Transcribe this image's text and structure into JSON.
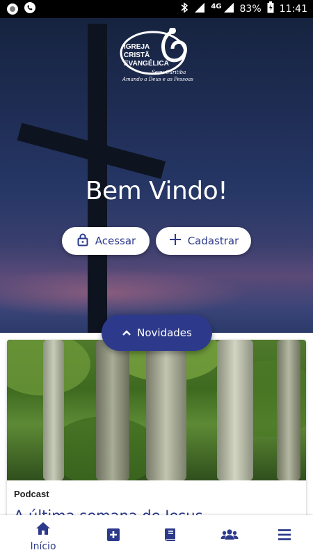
{
  "status_bar": {
    "network": "4G",
    "battery": "83%",
    "time": "11:41"
  },
  "hero": {
    "logo": {
      "line1": "IGREJA",
      "line2": "CRISTÃ",
      "line3": "EVANGÉLICA",
      "signature": "Sepu Curitiba",
      "tagline": "Amando a Deus e as Pessoas"
    },
    "welcome": "Bem Vindo!",
    "login_label": "Acessar",
    "register_label": "Cadastrar"
  },
  "news_button": {
    "label": "Novidades"
  },
  "card": {
    "category": "Podcast",
    "title": "A última semana de Jesus"
  },
  "bottom_nav": {
    "home_label": "Início"
  },
  "colors": {
    "primary": "#2d3a8c",
    "hero_top": "#16233f",
    "white": "#ffffff"
  }
}
